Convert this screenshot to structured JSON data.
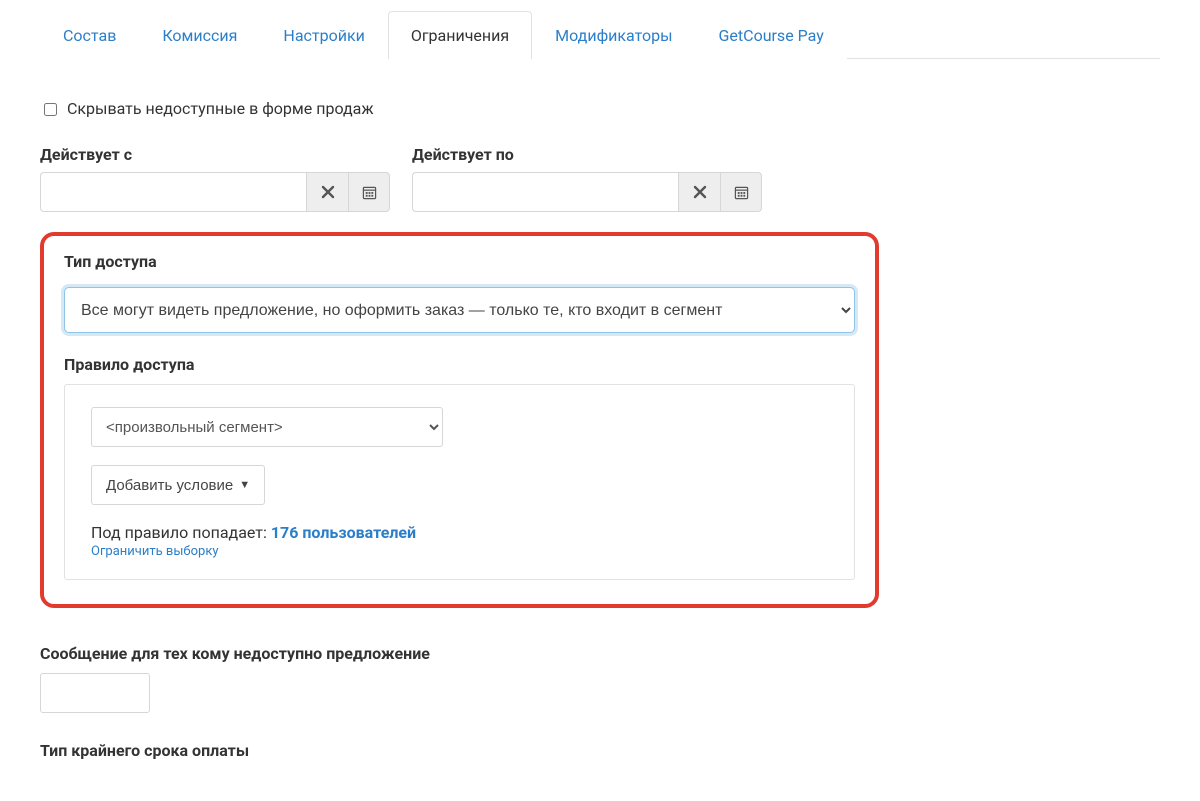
{
  "tabs": {
    "items": [
      {
        "label": "Состав",
        "active": false
      },
      {
        "label": "Комиссия",
        "active": false
      },
      {
        "label": "Настройки",
        "active": false
      },
      {
        "label": "Ограничения",
        "active": true
      },
      {
        "label": "Модификаторы",
        "active": false
      },
      {
        "label": "GetCourse Pay",
        "active": false
      }
    ]
  },
  "hide_checkbox": {
    "label": "Скрывать недоступные в форме продаж",
    "checked": false
  },
  "dates": {
    "from_label": "Действует с",
    "to_label": "Действует по",
    "from_value": "",
    "to_value": ""
  },
  "access_type": {
    "label": "Тип доступа",
    "selected": "Все могут видеть предложение, но оформить заказ — только те, кто входит в сегмент"
  },
  "access_rule": {
    "label": "Правило доступа",
    "segment_placeholder": "<произвольный сегмент>",
    "add_condition_label": "Добавить условие",
    "matches_prefix": "Под правило попадает: ",
    "matches_count": "176 пользователей",
    "limit_link": "Ограничить выборку"
  },
  "unavailable_message": {
    "label": "Сообщение для тех кому недоступно предложение",
    "value": ""
  },
  "deadline": {
    "label": "Тип крайнего срока оплаты"
  }
}
